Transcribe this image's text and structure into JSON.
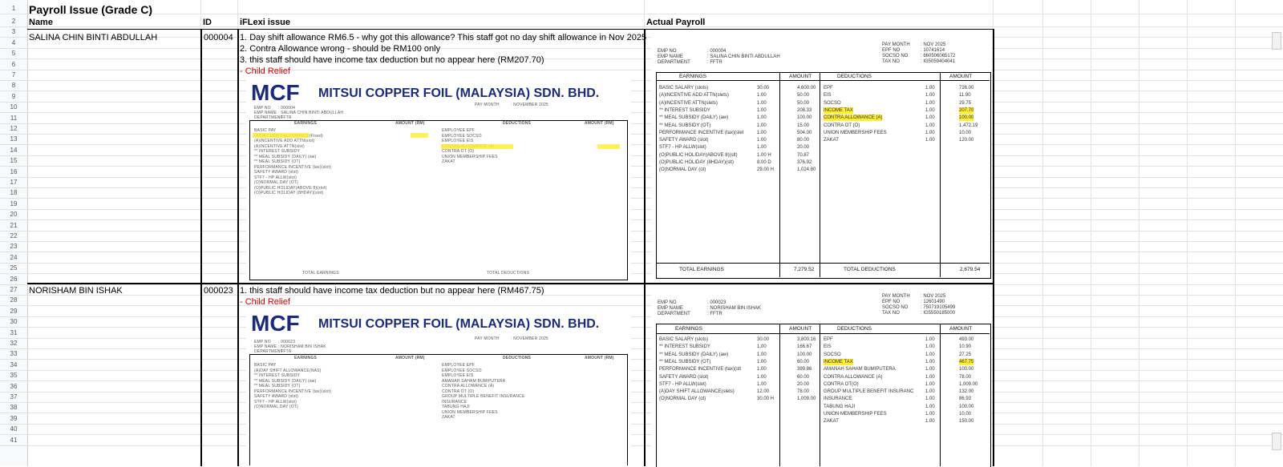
{
  "sheet": {
    "title": "Payroll Issue (Grade C)",
    "headers": {
      "name": "Name",
      "id": "ID",
      "issue": "iFLexi issue",
      "actual": "Actual Payroll"
    },
    "row_numbers": [
      "1",
      "2",
      "3",
      "4",
      "5",
      "6",
      "7",
      "8",
      "9",
      "10",
      "11",
      "12",
      "13",
      "14",
      "15",
      "16",
      "17",
      "18",
      "19",
      "20",
      "21",
      "22",
      "23",
      "24",
      "25",
      "26",
      "27",
      "28",
      "29",
      "30",
      "31",
      "32",
      "33",
      "34",
      "35",
      "36",
      "37",
      "38",
      "39",
      "40",
      "41"
    ]
  },
  "records": [
    {
      "name": "SALINA CHIN BINTI ABDULLAH",
      "id": "000004",
      "issues": [
        "1. Day shift allowance RM6.5 - why got this allowance? This staff got no day shift allowance in Nov 2025",
        "2. Contra Allowance wrong - should be RM100 only",
        "3. this staff should have income tax deduction but no appear here (RM207.70)"
      ],
      "note": "- Child Relief",
      "iflexi": {
        "logo": "MCF",
        "company": "MITSUI COPPER FOIL (MALAYSIA) SDN. BHD.",
        "labels": [
          "EMP NO",
          "EMP NAME",
          "DEPARTMENT"
        ],
        "values": [
          ": 000004",
          ": SALINA CHIN BINTI ABDULLAH",
          ": FFTR"
        ],
        "pay_month_label": "PAY MONTH",
        "pay_month": ": NOVEMBER 2025",
        "earnings_header": "EARNINGS",
        "amount_header": "AMOUNT (RM)",
        "deductions_header": "DEDUCTIONS",
        "earnings": [
          "BASIC PAY",
          "(A)DAY SHIFT ALLOWANCE(Fixed)",
          "(A)INCENTIVE ADD ATTN(slot)",
          "(A)INCENTIVE ATTN(slot)",
          "** INTEREST SUBSIDY",
          "** MEAL SUBSIDY (DAILY) (aw)",
          "** MEAL SUBSIDY (OT)",
          "PERFORMANCE INCENTIVE (tax)(slot)",
          "SAFETY AWARD (slot)",
          "STF7 - HP ALLW(slot)",
          "(O)NORMAL DAY (OT)",
          "(O)PUBLIC HOLIDAY(ABOVE 8)(slot)",
          "(O)PUBLIC HOLIDAY (8HDAY)(slot)"
        ],
        "deductions": [
          "EMPLOYEE EPF",
          "EMPLOYEE SOCSO",
          "EMPLOYEE EIS",
          "CONTRA ALLOWANCE (A)",
          "CONTRA OT (O)",
          "UNION MEMBERSHIP FEES",
          "ZAKAT"
        ],
        "total_earnings": "TOTAL EARNINGS",
        "total_deductions": "TOTAL DEDUCTIONS"
      },
      "actual": {
        "emp_labels": [
          "EMP NO",
          "EMP NAME",
          "DEPARTMENT"
        ],
        "emp_values": [
          ": 000004",
          ": SALINA CHIN BINTI ABDULLAH",
          ": FFTR"
        ],
        "right_labels": [
          "PAY MONTH",
          "EPF NO",
          "SOCSO NO",
          "TAX NO"
        ],
        "right_values": [
          ": NOV 2025",
          ": 10741614",
          ": 660506065172",
          ": IG5059404041"
        ],
        "earnings_header": "EARNINGS",
        "amount_header": "AMOUNT",
        "deductions_header": "DEDUCTIONS",
        "amount_header2": "AMOUNT",
        "earnings": [
          {
            "label": "BASIC SALARY (slots)",
            "qty": "30.00",
            "amount": "4,600.00"
          },
          {
            "label": "(A)INCENTIVE ADD ATTN(slets)",
            "qty": "1.00",
            "amount": "50.00"
          },
          {
            "label": "(A)INCENTIVE ATTN(slets)",
            "qty": "1.00",
            "amount": "50.00"
          },
          {
            "label": "** INTEREST SUBSIDY",
            "qty": "1.00",
            "amount": "208.33"
          },
          {
            "label": "** MEAL SUBSIDY (DAILY) (aw)",
            "qty": "1.00",
            "amount": "100.00"
          },
          {
            "label": "** MEAL SUBSIDY (OT)",
            "qty": "1.00",
            "amount": "15.00"
          },
          {
            "label": "PERFORMANCE INCENTIVE (tax)(slet",
            "qty": "1.00",
            "amount": "504.00"
          },
          {
            "label": "SAFETY AWARD (slot)",
            "qty": "1.00",
            "amount": "80.00"
          },
          {
            "label": "STF7 - HP ALLW(slot)",
            "qty": "1.00",
            "amount": "20.00"
          },
          {
            "label": "(O)PUBLIC HOLIDAY(ABOVE 8)(slt)",
            "qty": "1.00 H",
            "amount": "70.87"
          },
          {
            "label": "(O)PUBLIC HOLIDAY (8HDAY)(slt)",
            "qty": "8.00 D",
            "amount": "376.92"
          },
          {
            "label": "(O)NORMAL DAY (ot)",
            "qty": "29.00 H",
            "amount": "1,024.80"
          }
        ],
        "deductions": [
          {
            "label": "EPF",
            "qty": "1.00",
            "amount": "726.00"
          },
          {
            "label": "EIS",
            "qty": "1.00",
            "amount": "11.90"
          },
          {
            "label": "SOCSO",
            "qty": "1.00",
            "amount": "29.75"
          },
          {
            "label": "INCOME TAX",
            "qty": "1.00",
            "amount": "207.70"
          },
          {
            "label": "CONTRA ALLOWANCE (A)",
            "qty": "1.00",
            "amount": "100.00"
          },
          {
            "label": "CONTRA OT (O)",
            "qty": "1.00",
            "amount": "1,472.19"
          },
          {
            "label": "UNION MEMBERSHIP FEES",
            "qty": "1.00",
            "amount": "10.00"
          },
          {
            "label": "ZAKAT",
            "qty": "1.00",
            "amount": "120.00"
          }
        ],
        "total_earnings_label": "TOTAL EARNINGS",
        "total_earnings": "7,279.52",
        "total_deductions_label": "TOTAL DEDUCTIONS",
        "total_deductions": "2,679.54"
      }
    },
    {
      "name": "NORISHAM BIN ISHAK",
      "id": "000023",
      "issues": [
        "1. this staff should have income tax deduction but no appear here (RM467.75)"
      ],
      "note": "- Child Relief",
      "iflexi": {
        "logo": "MCF",
        "company": "MITSUI COPPER FOIL (MALAYSIA) SDN. BHD.",
        "labels": [
          "EMP NO",
          "EMP NAME",
          "DEPARTMENT"
        ],
        "values": [
          ": 000023",
          ": NORISHAM BIN ISHAK",
          ": FFTR"
        ],
        "pay_month_label": "PAY MONTH",
        "pay_month": ": NOVEMBER 2025",
        "earnings_header": "EARNINGS",
        "amount_header": "AMOUNT (RM)",
        "deductions_header": "DEDUCTIONS",
        "earnings": [
          "BASIC PAY",
          "(A)DAY SHIFT ALLOWANCE(NAS)",
          "** INTEREST SUBSIDY",
          "** MEAL SUBSIDY (DAILY) (aw)",
          "** MEAL SUBSIDY (OT)",
          "PERFORMANCE INCENTIVE (tax)(slot)",
          "SAFETY AWARD (slot)",
          "STF7 - HP ALLW(slot)",
          "(O)NORMAL DAY (OT)"
        ],
        "deductions": [
          "EMPLOYEE EPF",
          "EMPLOYEE SOCSO",
          "EMPLOYEE EIS",
          "AMANAH SAHAM BUMIPUTERA",
          "CONTRA ALLOWANCE (A)",
          "CONTRA OT (O)",
          "GROUP MULTIPLE BENEFIT INSURANCE",
          "INSURANCE",
          "TABUNG HAJI",
          "UNION MEMBERSHIP FEES",
          "ZAKAT"
        ]
      },
      "actual": {
        "emp_labels": [
          "EMP NO",
          "EMP NAME",
          "DEPARTMENT"
        ],
        "emp_values": [
          ": 000023",
          ": NORISHAM BIN ISHAK",
          ": FFTR"
        ],
        "right_labels": [
          "PAY MONTH",
          "EPF NO",
          "SOCSO NO",
          "TAX NO"
        ],
        "right_values": [
          ": NOV 2025",
          ": 12601490",
          ": 750719105499",
          ": IG5550185000"
        ],
        "earnings_header": "EARNINGS",
        "amount_header": "AMOUNT",
        "deductions_header": "DEDUCTIONS",
        "amount_header2": "AMOUNT",
        "earnings": [
          {
            "label": "BASIC SALARY (slots)",
            "qty": "30.00",
            "amount": "3,800.16"
          },
          {
            "label": "** INTEREST SUBSIDY",
            "qty": "1.00",
            "amount": "166.67"
          },
          {
            "label": "** MEAL SUBSIDY (DAILY) (aw)",
            "qty": "1.00",
            "amount": "100.00"
          },
          {
            "label": "** MEAL SUBSIDY (OT)",
            "qty": "1.00",
            "amount": "60.00"
          },
          {
            "label": "PERFORMANCE INCENTIVE (tax)(slt",
            "qty": "1.00",
            "amount": "399.86"
          },
          {
            "label": "SAFETY AWARD (slot)",
            "qty": "1.00",
            "amount": "60.00"
          },
          {
            "label": "STF7 - HP ALLW(slot)",
            "qty": "1.00",
            "amount": "20.00"
          },
          {
            "label": "(A)DAY SHIFT ALLOWANCE(slets)",
            "qty": "12.00",
            "amount": "78.00"
          },
          {
            "label": "(O)NORMAL DAY (ot)",
            "qty": "30.00 H",
            "amount": "1,009.00"
          }
        ],
        "deductions": [
          {
            "label": "EPF",
            "qty": "1.00",
            "amount": "493.00"
          },
          {
            "label": "EIS",
            "qty": "1.00",
            "amount": "10.90"
          },
          {
            "label": "SOCSO",
            "qty": "1.00",
            "amount": "27.25"
          },
          {
            "label": "INCOME TAX",
            "qty": "1.00",
            "amount": "467.75"
          },
          {
            "label": "AMANAH SAHAM BUMIPUTERA",
            "qty": "1.00",
            "amount": "100.00"
          },
          {
            "label": "CONTRA ALLOWANCE (A)",
            "qty": "1.00",
            "amount": "78.00"
          },
          {
            "label": "CONTRA OT(O)",
            "qty": "1.00",
            "amount": "1,009.00"
          },
          {
            "label": "GROUP MULTIPLE BENEFIT INSURANC",
            "qty": "1.00",
            "amount": "132.00"
          },
          {
            "label": "INSURANCE",
            "qty": "1.00",
            "amount": "86.93"
          },
          {
            "label": "TABUNG HAJI",
            "qty": "1.00",
            "amount": "100.00"
          },
          {
            "label": "UNION MEMBERSHIP FEES",
            "qty": "1.00",
            "amount": "10.00"
          },
          {
            "label": "ZAKAT",
            "qty": "1.00",
            "amount": "150.00"
          }
        ]
      }
    }
  ],
  "colors": {
    "highlight": "#ffee33",
    "note_red": "#d40000",
    "logo_blue": "#1c2b78"
  }
}
